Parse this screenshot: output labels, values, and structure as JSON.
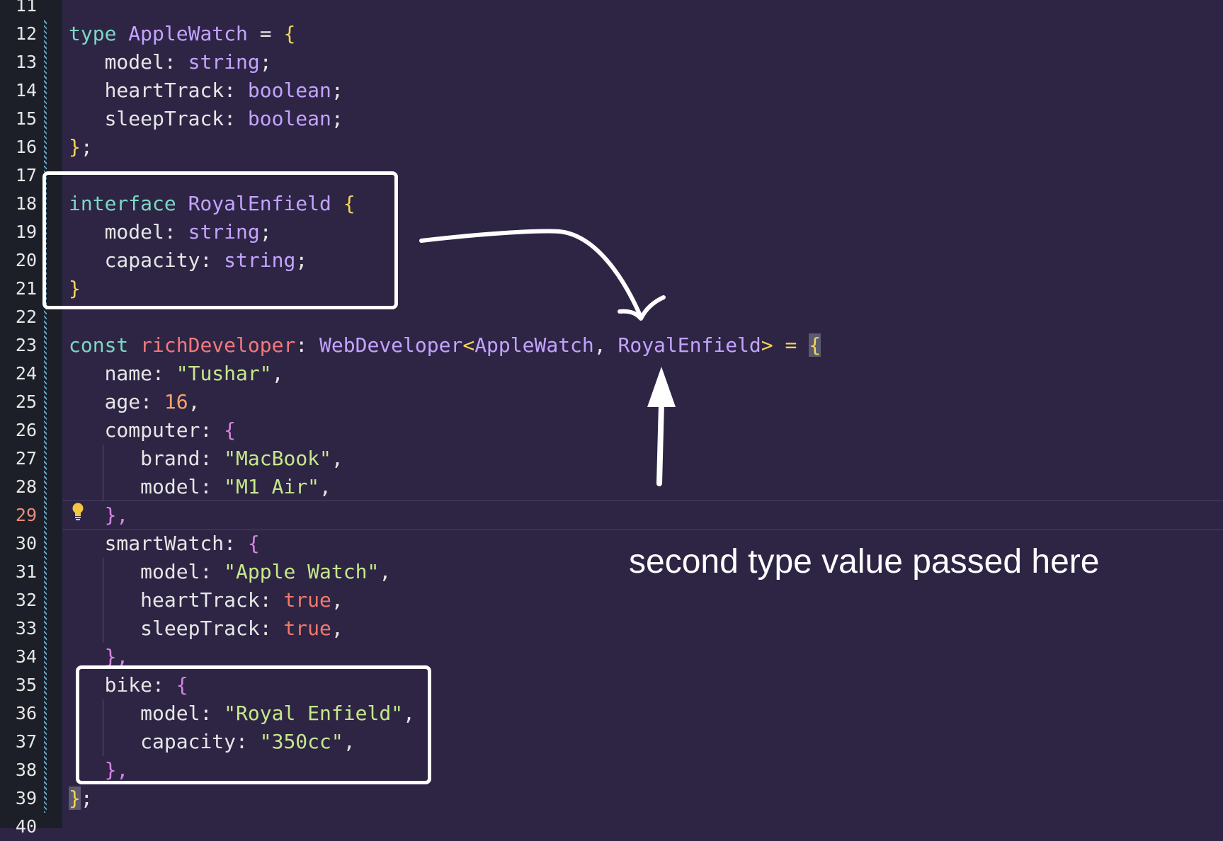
{
  "gutter": {
    "line_numbers": [
      "11",
      "12",
      "13",
      "14",
      "15",
      "16",
      "17",
      "18",
      "19",
      "20",
      "21",
      "22",
      "23",
      "24",
      "25",
      "26",
      "27",
      "28",
      "29",
      "30",
      "31",
      "32",
      "33",
      "34",
      "35",
      "36",
      "37",
      "38",
      "39",
      "40"
    ],
    "current_line": "29"
  },
  "code": {
    "l12": {
      "kw": "type",
      "name": "AppleWatch",
      "eq": "=",
      "brace": "{"
    },
    "l13": {
      "prop": "model",
      "type": "string"
    },
    "l14": {
      "prop": "heartTrack",
      "type": "boolean"
    },
    "l15": {
      "prop": "sleepTrack",
      "type": "boolean"
    },
    "l16": {
      "close": "}",
      "semi": ";"
    },
    "l18": {
      "kw": "interface",
      "name": "RoyalEnfield",
      "brace": "{"
    },
    "l19": {
      "prop": "model",
      "type": "string"
    },
    "l20": {
      "prop": "capacity",
      "type": "string"
    },
    "l21": {
      "close": "}"
    },
    "l23": {
      "kw": "const",
      "var": "richDeveloper",
      "type": "WebDeveloper",
      "arg1": "AppleWatch",
      "arg2": "RoyalEnfield",
      "eq": "=",
      "brace": "{"
    },
    "l24": {
      "prop": "name",
      "value": "\"Tushar\""
    },
    "l25": {
      "prop": "age",
      "value": "16"
    },
    "l26": {
      "prop": "computer",
      "brace": "{"
    },
    "l27": {
      "prop": "brand",
      "value": "\"MacBook\""
    },
    "l28": {
      "prop": "model",
      "value": "\"M1 Air\""
    },
    "l29": {
      "close": "},"
    },
    "l30": {
      "prop": "smartWatch",
      "brace": "{"
    },
    "l31": {
      "prop": "model",
      "value": "\"Apple Watch\""
    },
    "l32": {
      "prop": "heartTrack",
      "value": "true"
    },
    "l33": {
      "prop": "sleepTrack",
      "value": "true"
    },
    "l34": {
      "close": "},"
    },
    "l35": {
      "prop": "bike",
      "brace": "{"
    },
    "l36": {
      "prop": "model",
      "value": "\"Royal Enfield\""
    },
    "l37": {
      "prop": "capacity",
      "value": "\"350cc\""
    },
    "l38": {
      "close": "},"
    },
    "l39": {
      "close": "}",
      "semi": ";"
    }
  },
  "annotation": {
    "caption": "second type value passed here"
  },
  "colors": {
    "background": "#2e2545",
    "gutter": "#1c1f27",
    "keyword": "#7cd7c4",
    "type": "#c3a3ff",
    "string": "#c6e88a",
    "annotation": "#ffffff"
  },
  "icons": [
    "lightbulb-icon"
  ]
}
